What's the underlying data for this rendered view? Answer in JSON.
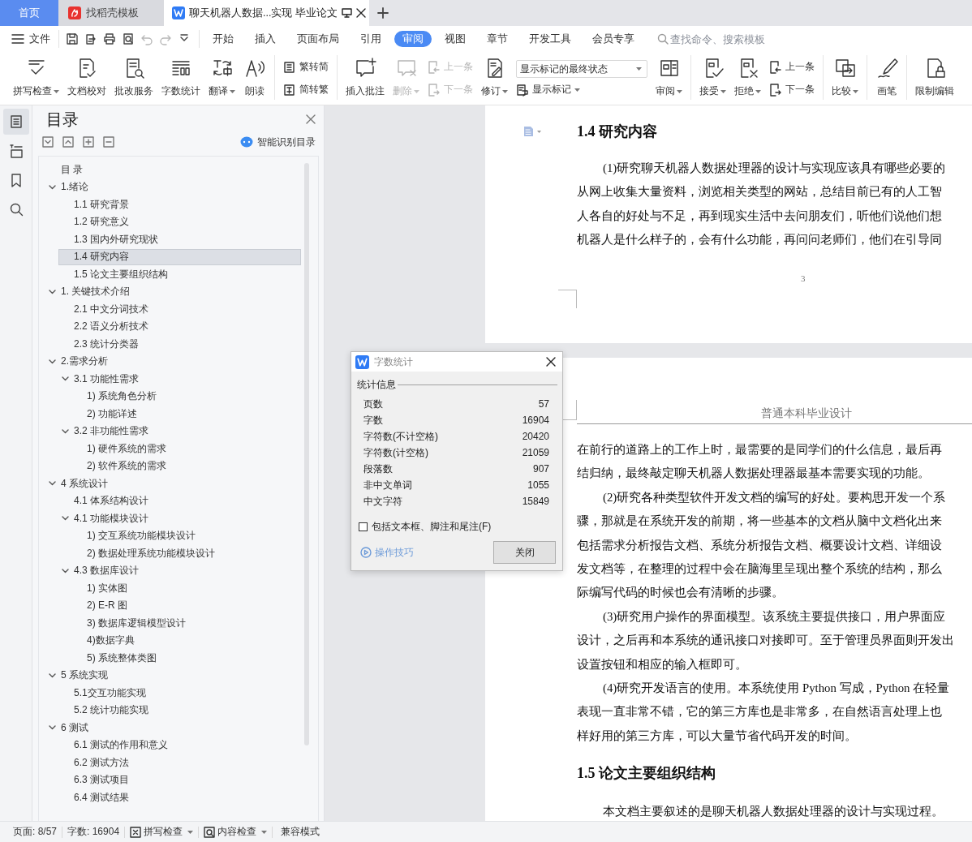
{
  "tabs": [
    {
      "label": "首页",
      "kind": "home",
      "selected": false
    },
    {
      "label": "找稻壳模板",
      "kind": "web",
      "selected": false
    },
    {
      "label": "聊天机器人数据...实现 毕业论文",
      "kind": "doc",
      "selected": true
    }
  ],
  "menu_bar": {
    "file_menu": "文件",
    "quick_access": [
      {
        "disabled": false
      },
      {
        "disabled": false
      },
      {
        "disabled": false
      },
      {
        "disabled": false
      },
      {
        "disabled": true
      },
      {
        "disabled": true
      },
      {
        "disabled": false
      }
    ],
    "menu_tabs": [
      {
        "label": "开始",
        "selected": false
      },
      {
        "label": "插入",
        "selected": false
      },
      {
        "label": "页面布局",
        "selected": false
      },
      {
        "label": "引用",
        "selected": false
      },
      {
        "label": "审阅",
        "selected": true
      },
      {
        "label": "视图",
        "selected": false
      },
      {
        "label": "章节",
        "selected": false
      },
      {
        "label": "开发工具",
        "selected": false
      },
      {
        "label": "会员专享",
        "selected": false
      }
    ],
    "search": {
      "placeholder": "查找命令、搜索模板"
    }
  },
  "ribbon": {
    "groups": [
      {
        "items": [
          {
            "kind": "large",
            "label": "拼写检查",
            "dropdown": true,
            "disabled": false
          },
          {
            "kind": "large",
            "label": "文档校对",
            "dropdown": false,
            "disabled": false
          },
          {
            "kind": "large",
            "label": "批改服务",
            "dropdown": false,
            "disabled": false
          },
          {
            "kind": "large",
            "label": "字数统计",
            "dropdown": false,
            "disabled": false
          },
          {
            "kind": "large",
            "label": "翻译",
            "dropdown": true,
            "disabled": false
          },
          {
            "kind": "large",
            "label": "朗读",
            "dropdown": false,
            "disabled": false
          }
        ]
      },
      {
        "items": [
          {
            "kind": "stack",
            "buttons": [
              {
                "label": "繁转简",
                "disabled": false
              },
              {
                "label": "简转繁",
                "disabled": false
              }
            ]
          }
        ]
      },
      {
        "items": [
          {
            "kind": "large",
            "label": "插入批注",
            "dropdown": false,
            "disabled": false
          },
          {
            "kind": "large",
            "label": "删除",
            "dropdown": true,
            "disabled": true
          },
          {
            "kind": "stack",
            "buttons": [
              {
                "label": "上一条",
                "disabled": true
              },
              {
                "label": "下一条",
                "disabled": true
              }
            ]
          },
          {
            "kind": "large",
            "label": "修订",
            "dropdown": true,
            "disabled": false
          },
          {
            "kind": "markup",
            "select": "显示标记的最终状态",
            "button": {
              "label": "显示标记",
              "dropdown": true
            }
          },
          {
            "kind": "large",
            "label": "审阅",
            "dropdown": true,
            "disabled": false
          }
        ]
      },
      {
        "items": [
          {
            "kind": "large",
            "label": "接受",
            "dropdown": true,
            "disabled": false
          },
          {
            "kind": "large",
            "label": "拒绝",
            "dropdown": true,
            "disabled": false
          },
          {
            "kind": "stack",
            "buttons": [
              {
                "label": "上一条",
                "disabled": false
              },
              {
                "label": "下一条",
                "disabled": false
              }
            ]
          }
        ]
      },
      {
        "items": [
          {
            "kind": "large",
            "label": "比较",
            "dropdown": true,
            "disabled": false
          }
        ]
      },
      {
        "items": [
          {
            "kind": "large",
            "label": "画笔",
            "dropdown": false,
            "disabled": false
          }
        ]
      },
      {
        "items": [
          {
            "kind": "large",
            "label": "限制编辑",
            "dropdown": false,
            "disabled": false
          }
        ]
      }
    ]
  },
  "side_rail": [
    {
      "selected": true
    },
    {
      "selected": false
    },
    {
      "selected": false
    },
    {
      "selected": false
    }
  ],
  "toc": {
    "title": "目录",
    "smart_button": "智能识别目录",
    "items": [
      {
        "label": "目 录",
        "selected": false
      },
      {
        "label": "1.绪论",
        "selected": false,
        "expanded": true,
        "children": [
          {
            "label": "1.1 研究背景",
            "selected": false
          },
          {
            "label": "1.2 研究意义",
            "selected": false
          },
          {
            "label": "1.3 国内外研究现状",
            "selected": false
          },
          {
            "label": "1.4 研究内容",
            "selected": true
          },
          {
            "label": "1.5 论文主要组织结构",
            "selected": false
          }
        ]
      },
      {
        "label": "1. 关键技术介绍",
        "selected": false,
        "expanded": true,
        "children": [
          {
            "label": "2.1 中文分词技术",
            "selected": false
          },
          {
            "label": "2.2 语义分析技术",
            "selected": false
          },
          {
            "label": "2.3 统计分类器",
            "selected": false
          }
        ]
      },
      {
        "label": "2.需求分析",
        "selected": false,
        "expanded": true,
        "children": [
          {
            "label": "3.1 功能性需求",
            "selected": false,
            "expanded": true,
            "children": [
              {
                "label": "1) 系统角色分析",
                "selected": false
              },
              {
                "label": "2) 功能详述",
                "selected": false
              }
            ]
          },
          {
            "label": "3.2 非功能性需求",
            "selected": false,
            "expanded": true,
            "children": [
              {
                "label": "1) 硬件系统的需求",
                "selected": false
              },
              {
                "label": "2) 软件系统的需求",
                "selected": false
              }
            ]
          }
        ]
      },
      {
        "label": "4 系统设计",
        "selected": false,
        "expanded": true,
        "children": [
          {
            "label": "4.1 体系结构设计",
            "selected": false
          },
          {
            "label": "4.1 功能模块设计",
            "selected": false,
            "expanded": true,
            "children": [
              {
                "label": "1) 交互系统功能模块设计",
                "selected": false
              },
              {
                "label": "2) 数据处理系统功能模块设计",
                "selected": false
              }
            ]
          },
          {
            "label": "4.3 数据库设计",
            "selected": false,
            "expanded": true,
            "children": [
              {
                "label": "1) 实体图",
                "selected": false
              },
              {
                "label": "2) E-R 图",
                "selected": false
              },
              {
                "label": "3) 数据库逻辑模型设计",
                "selected": false
              },
              {
                "label": "4)数据字典",
                "selected": false
              },
              {
                "label": "5) 系统整体类图",
                "selected": false
              }
            ]
          }
        ]
      },
      {
        "label": "5 系统实现",
        "selected": false,
        "expanded": true,
        "children": [
          {
            "label": "5.1交互功能实现",
            "selected": false
          },
          {
            "label": "5.2 统计功能实现",
            "selected": false
          }
        ]
      },
      {
        "label": "6 测试",
        "selected": false,
        "expanded": true,
        "children": [
          {
            "label": "6.1 测试的作用和意义",
            "selected": false
          },
          {
            "label": "6.2 测试方法",
            "selected": false
          },
          {
            "label": "6.3 测试项目",
            "selected": false
          },
          {
            "label": "6.4 测试结果",
            "selected": false
          }
        ]
      }
    ]
  },
  "document": {
    "pages": [
      {
        "blocks": [
          {
            "kind": "heading",
            "text": "1.4 研究内容"
          },
          {
            "kind": "paragraph",
            "first_line_indent": true,
            "lines": [
              "(1)研究聊天机器人数据处理器的设计与实现应该具有哪些必要的",
              "从网上收集大量资料，浏览相关类型的网站，总结目前已有的人工智",
              "人各自的好处与不足，再到现实生活中去问朋友们，听他们说他们想",
              "机器人是什么样子的，会有什么功能，再问问老师们，他们在引导同"
            ]
          }
        ],
        "page_number": "3"
      },
      {
        "header": "普通本科毕业设计",
        "blocks": [
          {
            "kind": "paragraph",
            "first_line_indent": false,
            "lines": [
              "在前行的道路上的工作上时，最需要的是同学们的什么信息，最后再",
              "结归纳，最终敲定聊天机器人数据处理器最基本需要实现的功能。"
            ]
          },
          {
            "kind": "paragraph",
            "first_line_indent": true,
            "lines": [
              "(2)研究各种类型软件开发文档的编写的好处。要构思开发一个系",
              "骤，那就是在系统开发的前期，将一些基本的文档从脑中文档化出来",
              "包括需求分析报告文档、系统分析报告文档、概要设计文档、详细设",
              "发文档等，在整理的过程中会在脑海里呈现出整个系统的结构，那么",
              "际编写代码的时候也会有清晰的步骤。"
            ]
          },
          {
            "kind": "paragraph",
            "first_line_indent": true,
            "lines": [
              "(3)研究用户操作的界面模型。该系统主要提供接口，用户界面应",
              "设计，之后再和本系统的通讯接口对接即可。至于管理员界面则开发出",
              "设置按钮和相应的输入框即可。"
            ]
          },
          {
            "kind": "paragraph",
            "first_line_indent": true,
            "lines": [
              "(4)研究开发语言的使用。本系统使用 Python 写成，Python 在轻量",
              "表现一直非常不错，它的第三方库也是非常多，在自然语言处理上也",
              "样好用的第三方库，可以大量节省代码开发的时间。"
            ]
          },
          {
            "kind": "heading",
            "text": "1.5 论文主要组织结构"
          },
          {
            "kind": "paragraph",
            "first_line_indent": true,
            "lines": [
              "本文档主要叙述的是聊天机器人数据处理器的设计与实现过程。"
            ]
          }
        ]
      }
    ]
  },
  "word_count_dialog": {
    "title": "字数统计",
    "section": "统计信息",
    "rows": [
      {
        "label": "页数",
        "value": "57"
      },
      {
        "label": "字数",
        "value": "16904"
      },
      {
        "label": "字符数(不计空格)",
        "value": "20420"
      },
      {
        "label": "字符数(计空格)",
        "value": "21059"
      },
      {
        "label": "段落数",
        "value": "907"
      },
      {
        "label": "非中文单词",
        "value": "1055"
      },
      {
        "label": "中文字符",
        "value": "15849"
      }
    ],
    "include_checkbox": {
      "label": "包括文本框、脚注和尾注(F)",
      "checked": false
    },
    "tips_link": "操作技巧",
    "close_button": "关闭"
  },
  "status_bar": {
    "page": "页面: 8/57",
    "word_count": "字数: 16904",
    "spell_check": "拼写检查",
    "content_check": "内容检查",
    "mode": "兼容模式"
  }
}
